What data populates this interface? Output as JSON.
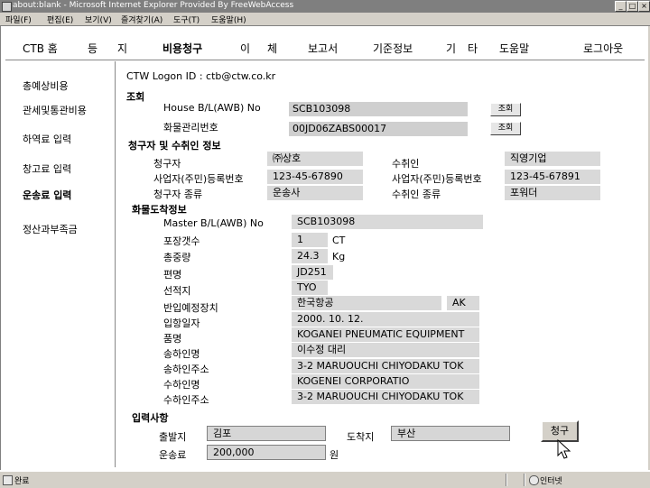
{
  "browser": {
    "title": "about:blank - Microsoft Internet Explorer Provided By FreeWebAccess",
    "menu": [
      "파일(F)",
      "편집(E)",
      "보기(V)",
      "즐겨찾기(A)",
      "도구(T)",
      "도움말(H)"
    ],
    "status_left": "완료",
    "status_zone": "인터넷"
  },
  "nav": {
    "items": [
      "CTB 홈",
      "등",
      "지",
      "비용청구",
      "이",
      "체",
      "보고서",
      "기준정보",
      "기",
      "타",
      "도움말",
      "로그아웃"
    ],
    "active": "비용청구"
  },
  "sidebar": {
    "items": [
      "총예상비용",
      "관세및통관비용",
      "하역료 입력",
      "창고료 입력",
      "운송료 입력",
      "정산과부족금"
    ],
    "active": "운송료 입력"
  },
  "logon": "CTW Logon ID : ctb@ctw.co.kr",
  "inquiry": {
    "section": "조회",
    "house_label": "House B/L(AWB) No",
    "house_value": "SCB103098",
    "cargo_label": "화물관리번호",
    "cargo_value": "00JD06ZABS00017",
    "button": "조회"
  },
  "parties": {
    "section": "청구자 및 수취인 정보",
    "claimant_label": "청구자",
    "claimant_value": "㈜상호",
    "reg_label": "사업자(주민)등록번호",
    "claimant_reg": "123-45-67890",
    "claimant_type_label": "청구자 종류",
    "claimant_type": "운송사",
    "payee_label": "수취인",
    "payee_value": "직영기업",
    "payee_reg": "123-45-67891",
    "payee_type_label": "수취인 종류",
    "payee_type": "포워더"
  },
  "arrival": {
    "section": "화물도착정보",
    "rows": [
      {
        "label": "Master B/L(AWB) No",
        "value": "SCB103098"
      },
      {
        "label": "포장갯수",
        "value": "1",
        "unit": "CT"
      },
      {
        "label": "총중량",
        "value": "24.3",
        "unit": "Kg"
      },
      {
        "label": "편명",
        "value": "JD251"
      },
      {
        "label": "선적지",
        "value": "TYO"
      },
      {
        "label": "반입예정장치",
        "value": "한국항공",
        "extra": "AK"
      },
      {
        "label": "입항일자",
        "value": "2000. 10. 12."
      },
      {
        "label": "품명",
        "value": "KOGANEI PNEUMATIC EQUIPMENT"
      },
      {
        "label": "송하인명",
        "value": "이수정 대리"
      },
      {
        "label": "송하인주소",
        "value": "3-2 MARUOUCHI CHIYODAKU TOK"
      },
      {
        "label": "수하인명",
        "value": "KOGENEI CORPORATIO"
      },
      {
        "label": "수하인주소",
        "value": "3-2 MARUOUCHI CHIYODAKU TOK"
      }
    ]
  },
  "input": {
    "section": "입력사항",
    "origin_label": "출발지",
    "origin_value": "김포",
    "dest_label": "도착지",
    "dest_value": "부산",
    "fee_label": "운송료",
    "fee_value": "200,000",
    "fee_unit": "원",
    "submit": "청구"
  }
}
